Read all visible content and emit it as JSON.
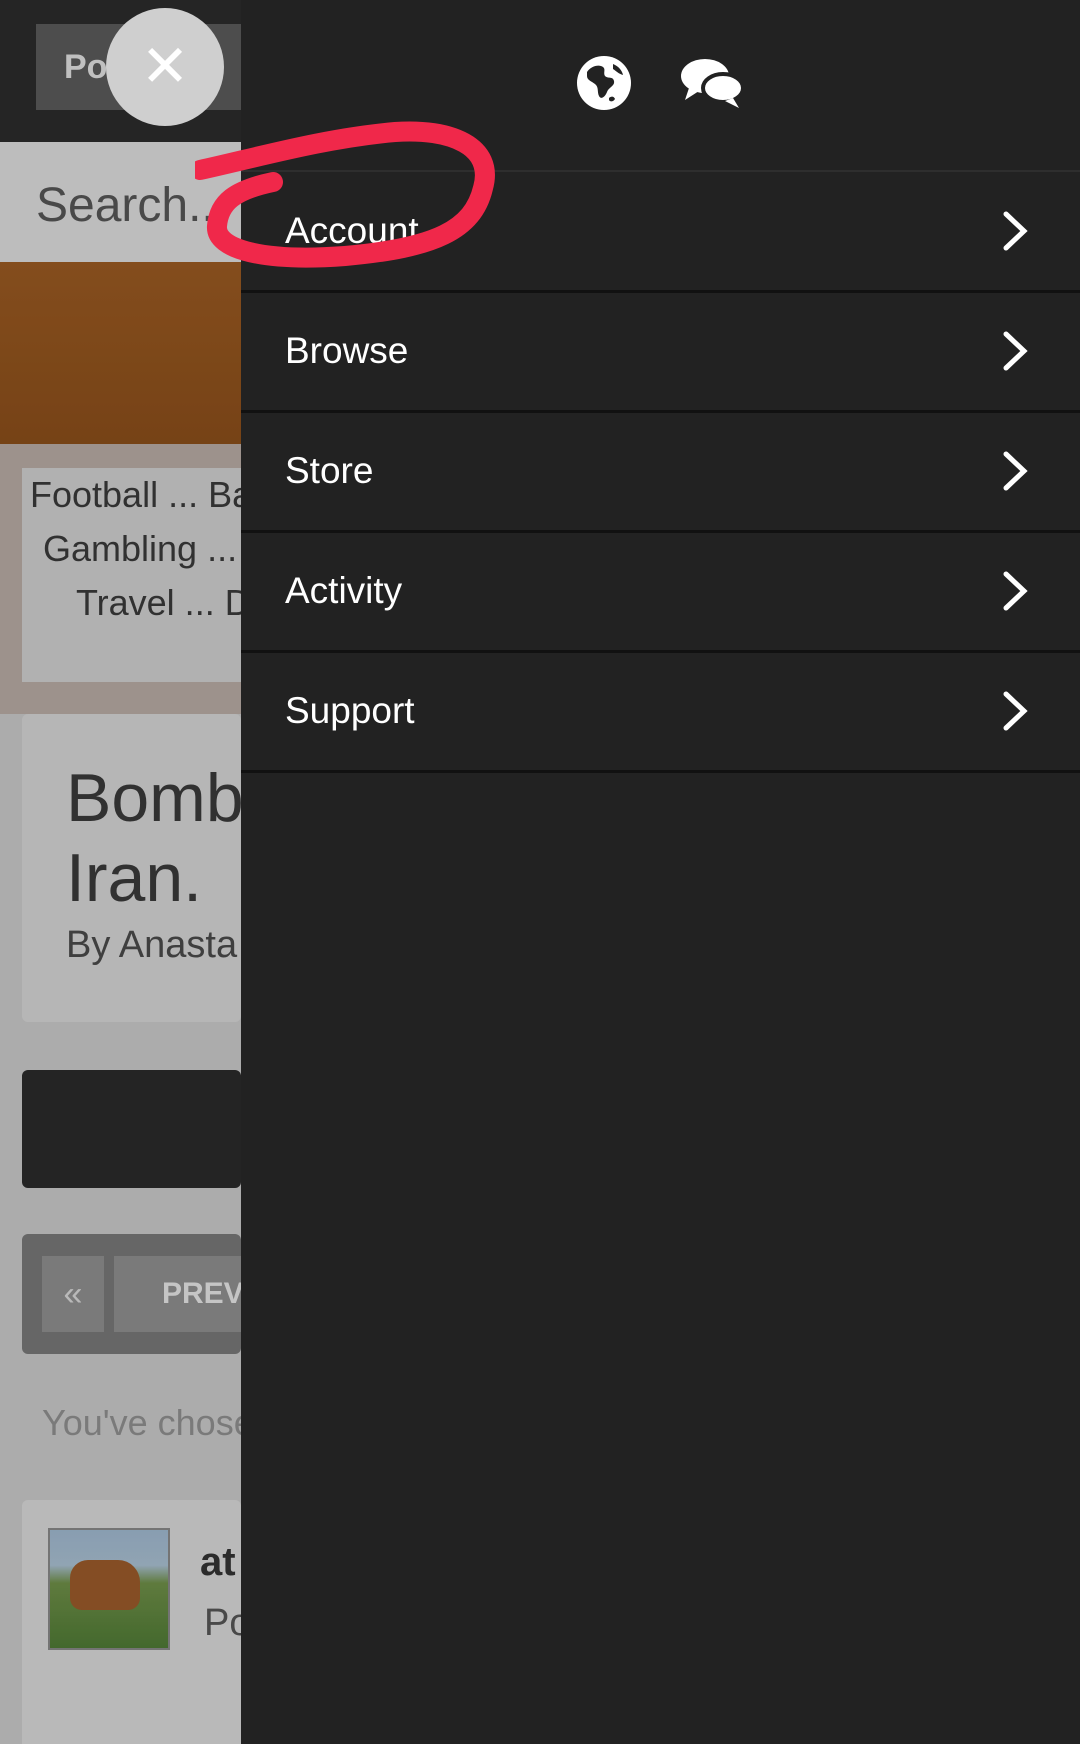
{
  "background_page": {
    "breadcrumb": "Po",
    "search_placeholder": "Search..",
    "tags": [
      "Football ... Ba",
      "Gambling ...",
      "Travel ... D"
    ],
    "post_title": "Bomb\nIran.",
    "post_author": "By Anasta",
    "pager": {
      "first": "«",
      "prev": "PREV"
    },
    "chosen_text": "You've chose",
    "comment": {
      "name": "at",
      "sub": "Po"
    }
  },
  "close_icon": "close-icon",
  "drawer": {
    "header_icons": [
      "globe-icon",
      "chat-bubbles-icon"
    ],
    "menu": [
      {
        "label": "Account"
      },
      {
        "label": "Browse"
      },
      {
        "label": "Store"
      },
      {
        "label": "Activity"
      },
      {
        "label": "Support"
      }
    ]
  },
  "colors": {
    "drawer_bg": "#222222",
    "annotation": "#f0284a"
  }
}
